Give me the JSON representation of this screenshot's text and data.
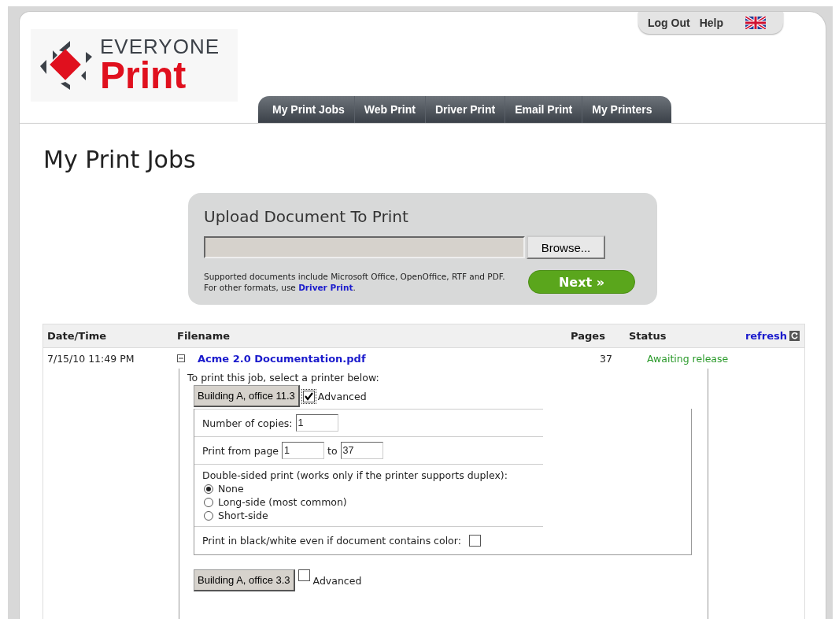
{
  "logo": {
    "line1": "EVERYONE",
    "line2": "Print"
  },
  "top_links": [
    "Log Out",
    "Help"
  ],
  "tabs": [
    "My Print Jobs",
    "Web Print",
    "Driver Print",
    "Email Print",
    "My Printers"
  ],
  "page_title": "My Print Jobs",
  "upload": {
    "title": "Upload Document To Print",
    "browse_button": "Browse...",
    "note": "Supported documents include Microsoft Office, OpenOffice, RTF and PDF. For other formats, use ",
    "note_link": "Driver Print",
    "note_end": ".",
    "next_button": "Next »"
  },
  "table": {
    "columns": [
      "Date/Time",
      "Filename",
      "Pages",
      "Status"
    ],
    "refresh": "refresh",
    "rows": [
      {
        "date": "7/15/10 11:49 PM",
        "expanded": true,
        "filename": "Acme 2.0 Documentation.pdf",
        "pages": "37",
        "status": "Awaiting release",
        "details": {
          "prompt": "To print this job, select a printer below:",
          "printers": [
            {
              "name": "Building A, office 11.3",
              "advanced_label": "Advanced",
              "advanced": true,
              "options": {
                "copies_label": "Number of copies:",
                "copies": "1",
                "range_label": "Print from page",
                "from": "1",
                "to_label": "to",
                "to": "37",
                "duplex_label": "Double-sided print (works only if the printer supports duplex):",
                "duplex": [
                  {
                    "label": "None",
                    "selected": true
                  },
                  {
                    "label": "Long-side (most common)",
                    "selected": false
                  },
                  {
                    "label": "Short-side",
                    "selected": false
                  }
                ],
                "bw_label": "Print in black/white even if document contains color:",
                "bw": false
              }
            },
            {
              "name": "Building A, office 3.3",
              "advanced_label": "Advanced",
              "advanced": false
            }
          ]
        }
      }
    ]
  }
}
